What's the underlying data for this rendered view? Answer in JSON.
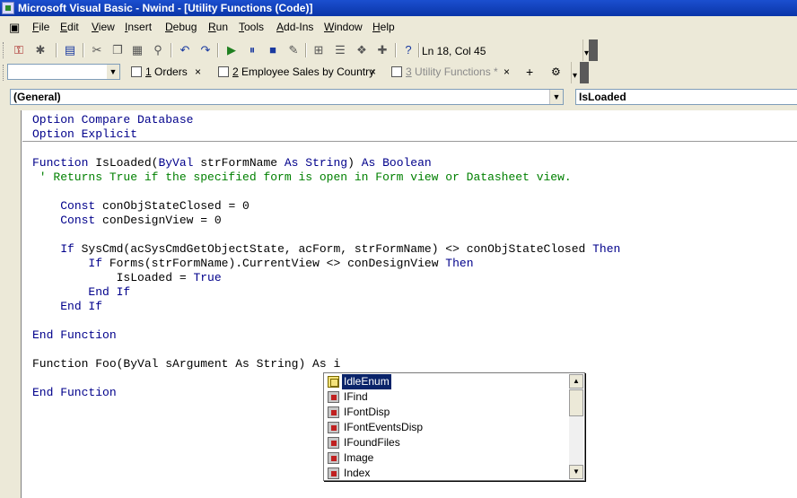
{
  "window": {
    "title": "Microsoft Visual Basic - Nwind - [Utility Functions (Code)]"
  },
  "menu": [
    {
      "label": "File",
      "u": "F",
      "rest": "ile"
    },
    {
      "label": "Edit",
      "u": "E",
      "rest": "dit"
    },
    {
      "label": "View",
      "u": "V",
      "rest": "iew"
    },
    {
      "label": "Insert",
      "u": "I",
      "rest": "nsert"
    },
    {
      "label": "Debug",
      "u": "D",
      "rest": "ebug"
    },
    {
      "label": "Run",
      "u": "R",
      "rest": "un"
    },
    {
      "label": "Tools",
      "u": "T",
      "rest": "ools"
    },
    {
      "label": "Add-Ins",
      "u": "A",
      "rest": "dd-Ins"
    },
    {
      "label": "Window",
      "u": "W",
      "rest": "indow"
    },
    {
      "label": "Help",
      "u": "H",
      "rest": "elp"
    }
  ],
  "toolbar": {
    "position": "Ln 18, Col 45",
    "icons": [
      "access-icon",
      "insert-module-icon",
      "save-icon",
      "cut-icon",
      "copy-icon",
      "paste-icon",
      "find-icon",
      "undo-icon",
      "redo-icon",
      "run-icon",
      "break-icon",
      "reset-icon",
      "design-mode-icon",
      "project-explorer-icon",
      "properties-icon",
      "object-browser-icon",
      "toolbox-icon",
      "help-icon"
    ]
  },
  "tabs": {
    "items": [
      {
        "num": "1",
        "label": " Orders"
      },
      {
        "num": "2",
        "label": " Employee Sales by Country"
      },
      {
        "num": "3",
        "label": " Utility Functions *"
      }
    ],
    "add": "+"
  },
  "dropdowns": {
    "object": "(General)",
    "procedure": "IsLoaded"
  },
  "code": [
    [
      {
        "t": "Option Compare Database",
        "c": "kw"
      }
    ],
    [
      {
        "t": "Option Explicit",
        "c": "kw"
      }
    ],
    [
      {
        "t": "",
        "c": ""
      }
    ],
    [
      {
        "t": "Function ",
        "c": "kw"
      },
      {
        "t": "IsLoaded(",
        "c": ""
      },
      {
        "t": "ByVal",
        "c": "kw"
      },
      {
        "t": " strFormName ",
        "c": ""
      },
      {
        "t": "As String",
        "c": "kw"
      },
      {
        "t": ") ",
        "c": ""
      },
      {
        "t": "As Boolean",
        "c": "kw"
      }
    ],
    [
      {
        "t": " ' Returns True if the specified form is open in Form view or Datasheet view.",
        "c": "cm"
      }
    ],
    [
      {
        "t": "",
        "c": ""
      }
    ],
    [
      {
        "t": "    ",
        "c": ""
      },
      {
        "t": "Const",
        "c": "kw"
      },
      {
        "t": " conObjStateClosed = 0",
        "c": ""
      }
    ],
    [
      {
        "t": "    ",
        "c": ""
      },
      {
        "t": "Const",
        "c": "kw"
      },
      {
        "t": " conDesignView = 0",
        "c": ""
      }
    ],
    [
      {
        "t": "",
        "c": ""
      }
    ],
    [
      {
        "t": "    ",
        "c": ""
      },
      {
        "t": "If",
        "c": "kw"
      },
      {
        "t": " SysCmd(acSysCmdGetObjectState, acForm, strFormName) <> conObjStateClosed ",
        "c": ""
      },
      {
        "t": "Then",
        "c": "kw"
      }
    ],
    [
      {
        "t": "        ",
        "c": ""
      },
      {
        "t": "If",
        "c": "kw"
      },
      {
        "t": " Forms(strFormName).CurrentView <> conDesignView ",
        "c": ""
      },
      {
        "t": "Then",
        "c": "kw"
      }
    ],
    [
      {
        "t": "            IsLoaded = ",
        "c": ""
      },
      {
        "t": "True",
        "c": "kw"
      }
    ],
    [
      {
        "t": "        ",
        "c": ""
      },
      {
        "t": "End If",
        "c": "kw"
      }
    ],
    [
      {
        "t": "    ",
        "c": ""
      },
      {
        "t": "End If",
        "c": "kw"
      }
    ],
    [
      {
        "t": "",
        "c": ""
      }
    ],
    [
      {
        "t": "End Function",
        "c": "kw"
      }
    ],
    [
      {
        "t": "",
        "c": ""
      }
    ],
    [
      {
        "t": "Function Foo(ByVal sArgument As String) As i",
        "c": ""
      }
    ],
    [
      {
        "t": "",
        "c": ""
      }
    ],
    [
      {
        "t": "End Function",
        "c": "kw"
      }
    ]
  ],
  "autocomplete": {
    "items": [
      {
        "label": "IdleEnum",
        "icon": "enum-icon",
        "selected": true
      },
      {
        "label": "IFind",
        "icon": "class-icon",
        "selected": false
      },
      {
        "label": "IFontDisp",
        "icon": "class-icon",
        "selected": false
      },
      {
        "label": "IFontEventsDisp",
        "icon": "class-icon",
        "selected": false
      },
      {
        "label": "IFoundFiles",
        "icon": "class-icon",
        "selected": false
      },
      {
        "label": "Image",
        "icon": "class-icon",
        "selected": false
      },
      {
        "label": "Index",
        "icon": "class-icon",
        "selected": false
      }
    ]
  }
}
